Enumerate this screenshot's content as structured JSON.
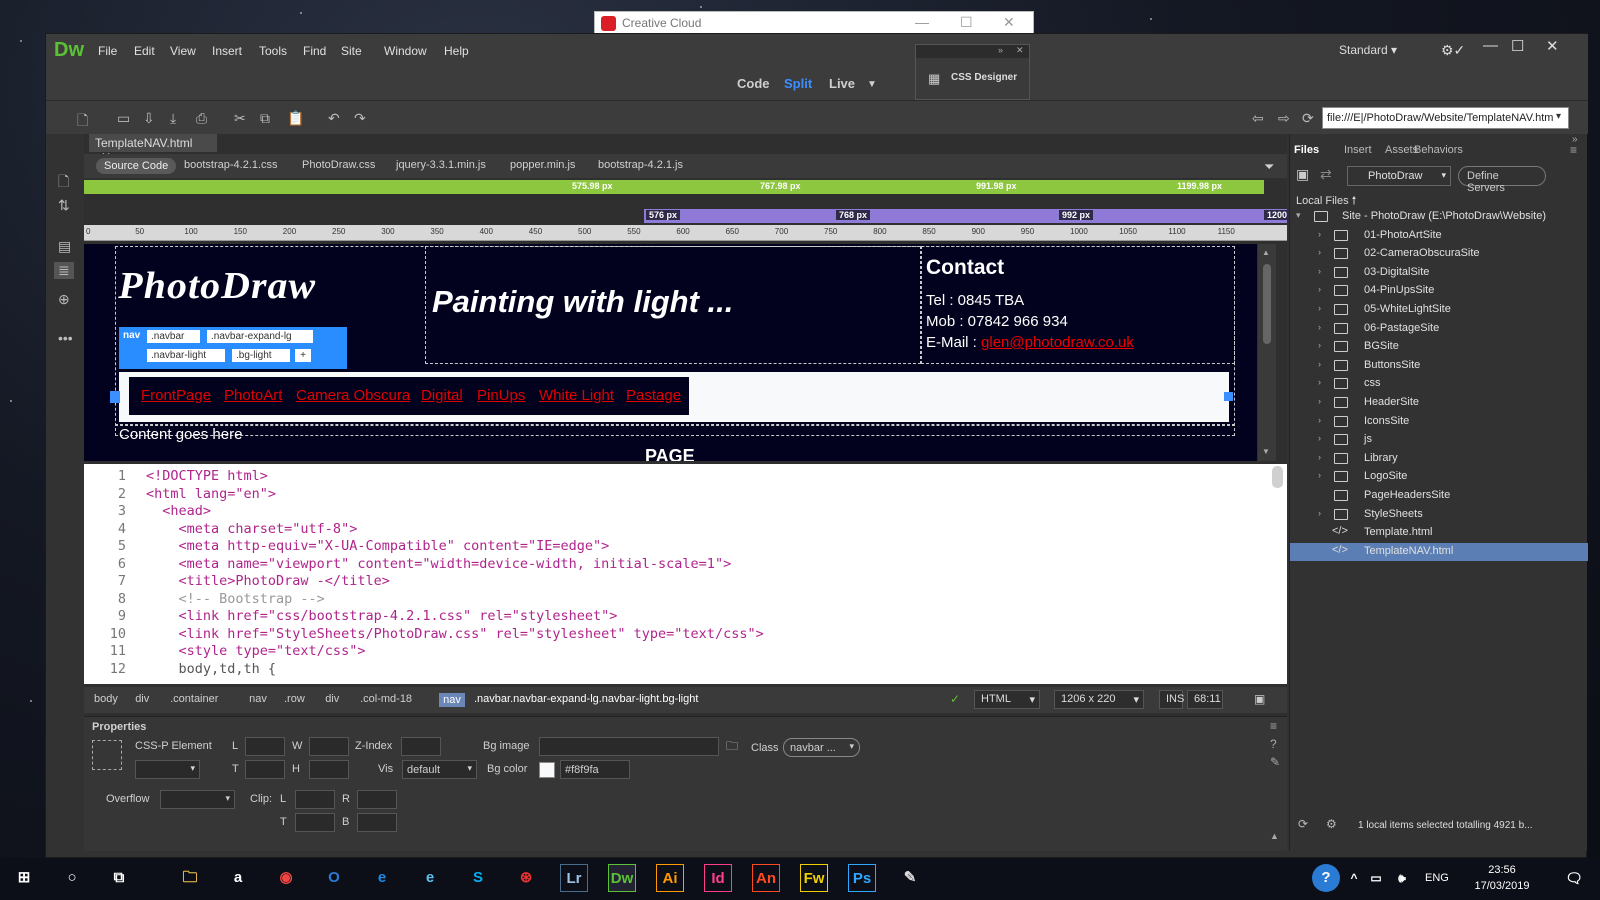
{
  "creative_cloud": {
    "title": "Creative Cloud"
  },
  "app": {
    "logo": "Dw",
    "menus": [
      "File",
      "Edit",
      "View",
      "Insert",
      "Tools",
      "Find",
      "Site",
      "Window",
      "Help"
    ],
    "workspace": "Standard"
  },
  "views": {
    "code": "Code",
    "split": "Split",
    "live": "Live"
  },
  "css_designer": {
    "label": "CSS Designer"
  },
  "address": {
    "url": "file:///E|/PhotoDraw/Website/TemplateNAV.htm"
  },
  "document": {
    "tab": "TemplateNAV.html",
    "source_code": "Source Code",
    "related_files": [
      "bootstrap-4.2.1.css",
      "PhotoDraw.css",
      "jquery-3.3.1.min.js",
      "popper.min.js",
      "bootstrap-4.2.1.js"
    ]
  },
  "media_queries": {
    "max": [
      "575.98 px",
      "767.98 px",
      "991.98 px",
      "1199.98 px"
    ],
    "min": [
      "576 px",
      "768 px",
      "992 px",
      "1200"
    ]
  },
  "ruler": [
    "0",
    "50",
    "100",
    "150",
    "200",
    "250",
    "300",
    "350",
    "400",
    "450",
    "500",
    "550",
    "600",
    "650",
    "700",
    "750",
    "800",
    "850",
    "900",
    "950",
    "1000",
    "1050",
    "1100",
    "1150"
  ],
  "live": {
    "logo": "PhotoDraw",
    "tagline": "Painting with light ...",
    "contact_heading": "Contact",
    "tel": "Tel : 0845 TBA",
    "mob": "Mob : 07842 966 934",
    "email_label": "E-Mail :",
    "email": "glen@photodraw.co.uk",
    "nav_tag": "nav",
    "nav_classes": [
      ".navbar",
      ".navbar-expand-lg",
      ".navbar-light",
      ".bg-light",
      "+"
    ],
    "nav_links": [
      "FrontPage",
      "PhotoArt",
      "Camera Obscura",
      "Digital",
      "PinUps",
      "White Light",
      "Pastage"
    ],
    "content": "Content goes here",
    "page_text": "PAGE"
  },
  "code": [
    {
      "n": "1",
      "t": "<!DOCTYPE html>"
    },
    {
      "n": "2",
      "t": "<html lang=\"en\">"
    },
    {
      "n": "3",
      "t": "  <head>"
    },
    {
      "n": "4",
      "t": "    <meta charset=\"utf-8\">"
    },
    {
      "n": "5",
      "t": "    <meta http-equiv=\"X-UA-Compatible\" content=\"IE=edge\">"
    },
    {
      "n": "6",
      "t": "    <meta name=\"viewport\" content=\"width=device-width, initial-scale=1\">"
    },
    {
      "n": "7",
      "t": "    <title>PhotoDraw -</title>"
    },
    {
      "n": "8",
      "t": "    <!-- Bootstrap -->"
    },
    {
      "n": "9",
      "t": "    <link href=\"css/bootstrap-4.2.1.css\" rel=\"stylesheet\">"
    },
    {
      "n": "10",
      "t": "    <link href=\"StyleSheets/PhotoDraw.css\" rel=\"stylesheet\" type=\"text/css\">"
    },
    {
      "n": "11",
      "t": "    <style type=\"text/css\">"
    },
    {
      "n": "12",
      "t": "    body,td,th {"
    }
  ],
  "status": {
    "crumbs": [
      "body",
      "div",
      ".container",
      "nav",
      ".row",
      "div",
      ".col-md-18",
      "nav",
      ".navbar.navbar-expand-lg.navbar-light.bg-light"
    ],
    "lang": "HTML",
    "size": "1206 x 220",
    "mode": "INS",
    "pos": "68:11"
  },
  "properties": {
    "title": "Properties",
    "element": "CSS-P Element",
    "L": "L",
    "W": "W",
    "T": "T",
    "H": "H",
    "zindex": "Z-Index",
    "vis": "Vis",
    "vis_value": "default",
    "bg_image": "Bg image",
    "bg_color": "Bg color",
    "bg_color_value": "#f8f9fa",
    "class": "Class",
    "class_value": "navbar ...",
    "overflow": "Overflow",
    "clip": "Clip:",
    "clip_L": "L",
    "clip_R": "R",
    "clip_T": "T",
    "clip_B": "B"
  },
  "files": {
    "tabs": [
      "Files",
      "Insert",
      "Assets",
      "Behaviors"
    ],
    "site": "PhotoDraw",
    "define": "Define Servers",
    "local": "Local Files",
    "root": "Site - PhotoDraw (E:\\PhotoDraw\\Website)",
    "items": [
      "01-PhotoArtSite",
      "02-CameraObscuraSite",
      "03-DigitalSite",
      "04-PinUpsSite",
      "05-WhiteLightSite",
      "06-PastageSite",
      "BGSite",
      "ButtonsSite",
      "css",
      "HeaderSite",
      "IconsSite",
      "js",
      "Library",
      "LogoSite",
      "PageHeadersSite",
      "StyleSheets",
      "Template.html",
      "TemplateNAV.html"
    ],
    "status": "1 local items selected totalling 4921 b..."
  },
  "taskbar": {
    "lang": "ENG",
    "time": "23:56",
    "date": "17/03/2019"
  },
  "colors": {
    "dw_green": "#5bc236",
    "nav_blue": "#2a8dff",
    "mq_green": "#8dc63f",
    "mq_purple": "#8f7ad8",
    "link_red": "#e10000",
    "page_bg": "#02021e"
  }
}
